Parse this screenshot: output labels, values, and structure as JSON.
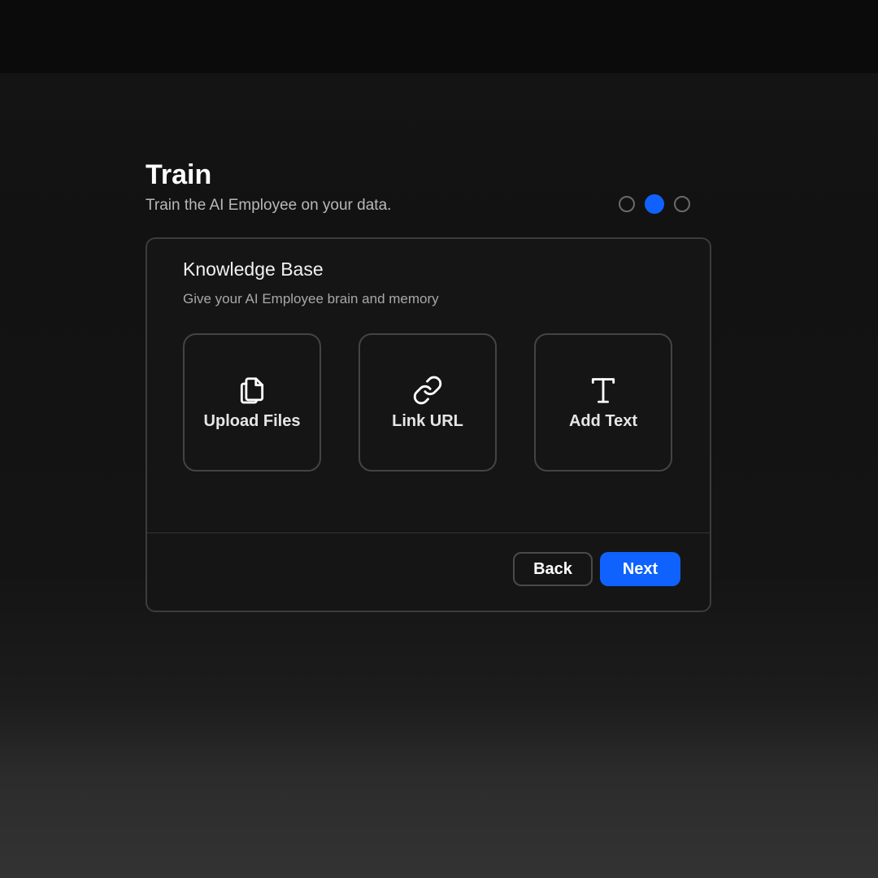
{
  "header": {
    "title": "Train",
    "subtitle": "Train the AI Employee on your data."
  },
  "stepper": {
    "total": 3,
    "current": 2,
    "active_color": "#0f62fe"
  },
  "card": {
    "title": "Knowledge Base",
    "subtitle": "Give your AI Employee brain and memory",
    "options": [
      {
        "label": "Upload Files",
        "icon": "files-icon"
      },
      {
        "label": "Link URL",
        "icon": "link-icon"
      },
      {
        "label": "Add Text",
        "icon": "text-icon"
      }
    ]
  },
  "footer": {
    "back_label": "Back",
    "next_label": "Next"
  }
}
